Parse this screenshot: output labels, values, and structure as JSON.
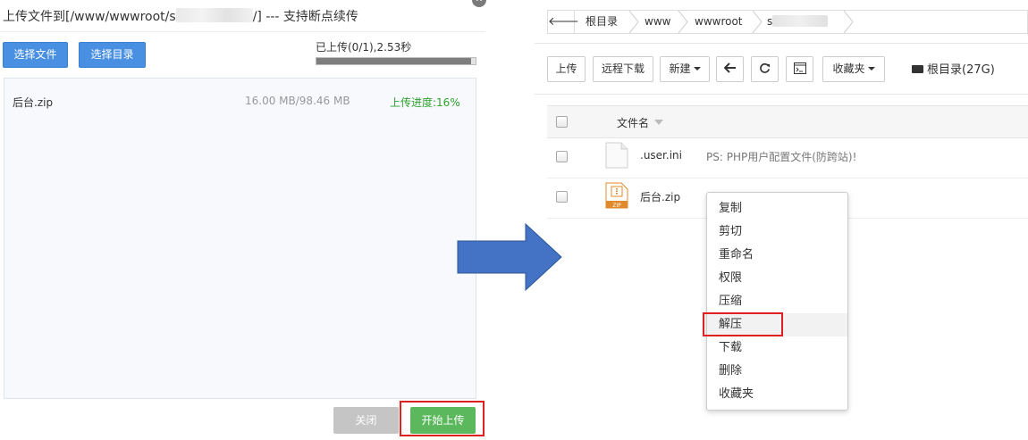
{
  "upload_dialog": {
    "title_prefix": "上传文件到[/www/wwwroot/s",
    "title_suffix": "/] --- 支持断点续传",
    "close_glyph": "✕",
    "buttons": {
      "choose_file": "选择文件",
      "choose_dir": "选择目录",
      "close": "关闭",
      "start_upload": "开始上传"
    },
    "status_text": "已上传(0/1),2.53秒",
    "overall_progress": 0.97,
    "files": [
      {
        "name": "后台.zip",
        "size": "16.00 MB/98.46 MB",
        "progress": "上传进度:16%"
      }
    ]
  },
  "file_manager": {
    "breadcrumb": [
      "根目录",
      "www",
      "wwwroot",
      "s"
    ],
    "toolbar": {
      "upload": "上传",
      "remote_download": "远程下载",
      "new": "新建",
      "favorites": "收藏夹",
      "disk": "根目录(27G)"
    },
    "table": {
      "header_name": "文件名",
      "rows": [
        {
          "name": ".user.ini",
          "note": "PS: PHP用户配置文件(防跨站)!",
          "icon": "blank-file-icon"
        },
        {
          "name": "后台.zip",
          "note": "",
          "icon": "zip-file-icon",
          "icon_label": "ZIP"
        }
      ]
    },
    "context_menu": [
      "复制",
      "剪切",
      "重命名",
      "权限",
      "压缩",
      "解压",
      "下载",
      "删除",
      "收藏夹"
    ],
    "highlighted_menu_item": "解压"
  },
  "colors": {
    "primary_blue": "#4a90e2",
    "success_green": "#5cb85c",
    "progress_text_green": "#2ea12e",
    "highlight_red": "#e02020",
    "arrow_blue": "#4472c4"
  }
}
